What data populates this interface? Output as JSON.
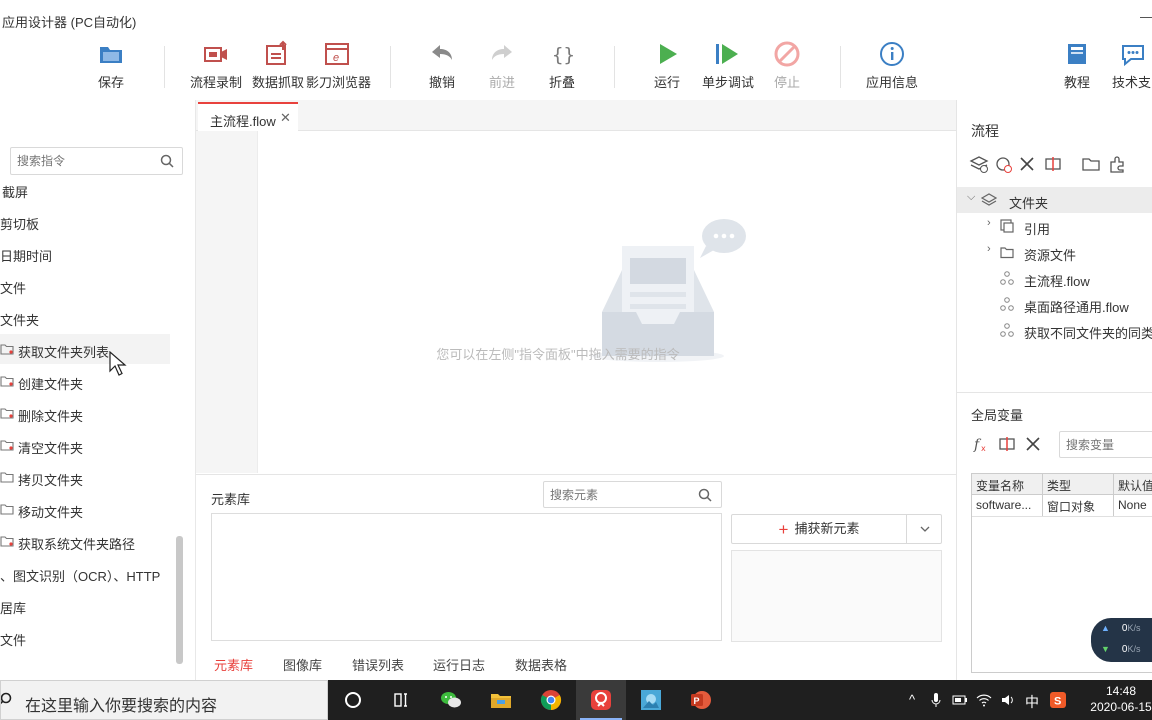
{
  "app": {
    "title": "应用设计器 (PC自动化)"
  },
  "toolbar": {
    "save": "保存",
    "record": "流程录制",
    "grab": "数据抓取",
    "browser": "影刀浏览器",
    "undo": "撤销",
    "redo": "前进",
    "fold": "折叠",
    "run": "运行",
    "debug": "单步调试",
    "stop": "停止",
    "appinfo": "应用信息",
    "tutorial": "教程",
    "support": "技术支"
  },
  "left": {
    "search_placeholder": "搜索指令",
    "items": [
      "截屏",
      "剪切板",
      "日期时间",
      "文件",
      "文件夹",
      "获取文件夹列表",
      "创建文件夹",
      "删除文件夹",
      "清空文件夹",
      "拷贝文件夹",
      "移动文件夹",
      "获取系统文件夹路径",
      "、图文识别（OCR）、HTTP",
      "居库",
      "文件",
      "."
    ]
  },
  "editor": {
    "tab_label": "主流程.flow",
    "tab_close": "✕",
    "empty_hint": "您可以在左侧\"指令面板\"中拖入需要的指令"
  },
  "elements": {
    "title": "元素库",
    "search_placeholder": "搜索元素",
    "capture_plus": "+",
    "capture_label": "捕获新元素",
    "tabs": [
      "元素库",
      "图像库",
      "错误列表",
      "运行日志",
      "数据表格"
    ]
  },
  "flow_panel": {
    "title": "流程",
    "tree": {
      "root": "文件夹",
      "children": [
        "引用",
        "资源文件",
        "主流程.flow",
        "桌面路径通用.flow",
        "获取不同文件夹的同类文"
      ]
    }
  },
  "globals": {
    "title": "全局变量",
    "search_placeholder": "搜索变量",
    "columns": [
      "变量名称",
      "类型",
      "默认值"
    ],
    "rows": [
      [
        "software...",
        "窗口对象",
        "None"
      ]
    ]
  },
  "network": {
    "up": "0",
    "down": "0",
    "unit": "K/s"
  },
  "taskbar": {
    "search_text": "在这里输入你要搜索的内容",
    "ime": "中",
    "time": "14:48",
    "date": "2020-06-15"
  },
  "colors": {
    "accent": "#e8413c",
    "run_green": "#4caf50",
    "icon_blue": "#3b7fc4"
  }
}
